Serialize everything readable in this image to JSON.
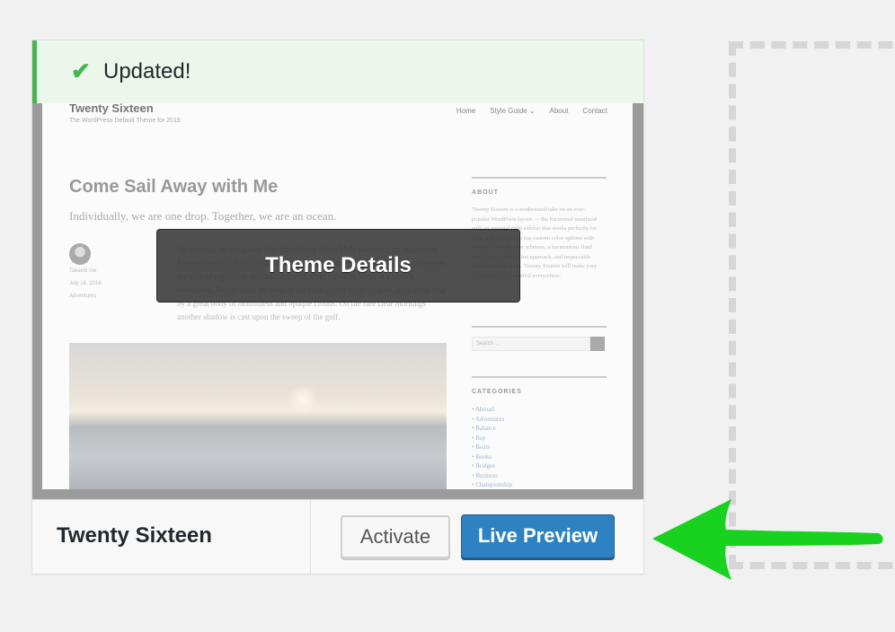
{
  "notice": {
    "check_icon": "✔",
    "message": "Updated!",
    "color": "#46b450"
  },
  "preview": {
    "site_title": "Twenty Sixteen",
    "site_description": "The WordPress Default Theme for 2016",
    "menu": [
      "Home",
      "Style Guide ⌄",
      "About",
      "Contact"
    ],
    "post_title": "Come Sail Away with Me",
    "post_subtitle": "Individually, we are one drop. Together, we are an ocean.",
    "author": "Takashi Irie",
    "date": "July 16, 2016",
    "category": "Adventures",
    "body": "On crossing the imaginary line drawn from Punta Mala to Azuera the ships from Europe bound to Sulaco lose at once the strong breezes of the ocean. They become the prey of capricious airs that play with them for thirty hours at a stretch sometimes. Before them the head of the calm gulf is filled on most days of the year by a great body of motionless and opaque clouds. On the rare clear mornings another shadow is cast upon the sweep of the gulf.",
    "sidebar_about_heading": "ABOUT",
    "sidebar_about_text": "Twenty Sixteen is a modernized take on an ever-popular WordPress layout — the horizontal masthead with an optional right sidebar that works perfectly for blogs and websites. It has custom color options with beautiful default color schemes, a harmonious fluid grid using a mobile-first approach, and impeccable polish in every detail. Twenty Sixteen will make your WordPress look beautiful everywhere.",
    "search_placeholder": "Search ...",
    "categories_heading": "CATEGORIES",
    "categories": [
      "Abroad",
      "Adventures",
      "Balance",
      "Bay",
      "Boats",
      "Books",
      "Bridges",
      "Business",
      "Championship"
    ]
  },
  "theme_details_label": "Theme Details",
  "theme_bar": {
    "name": "Twenty Sixteen",
    "activate_label": "Activate",
    "live_preview_label": "Live Preview",
    "live_preview_color": "#2e82c2"
  },
  "annotation": {
    "arrow_icon": "green-arrow",
    "color": "#19d11f"
  }
}
